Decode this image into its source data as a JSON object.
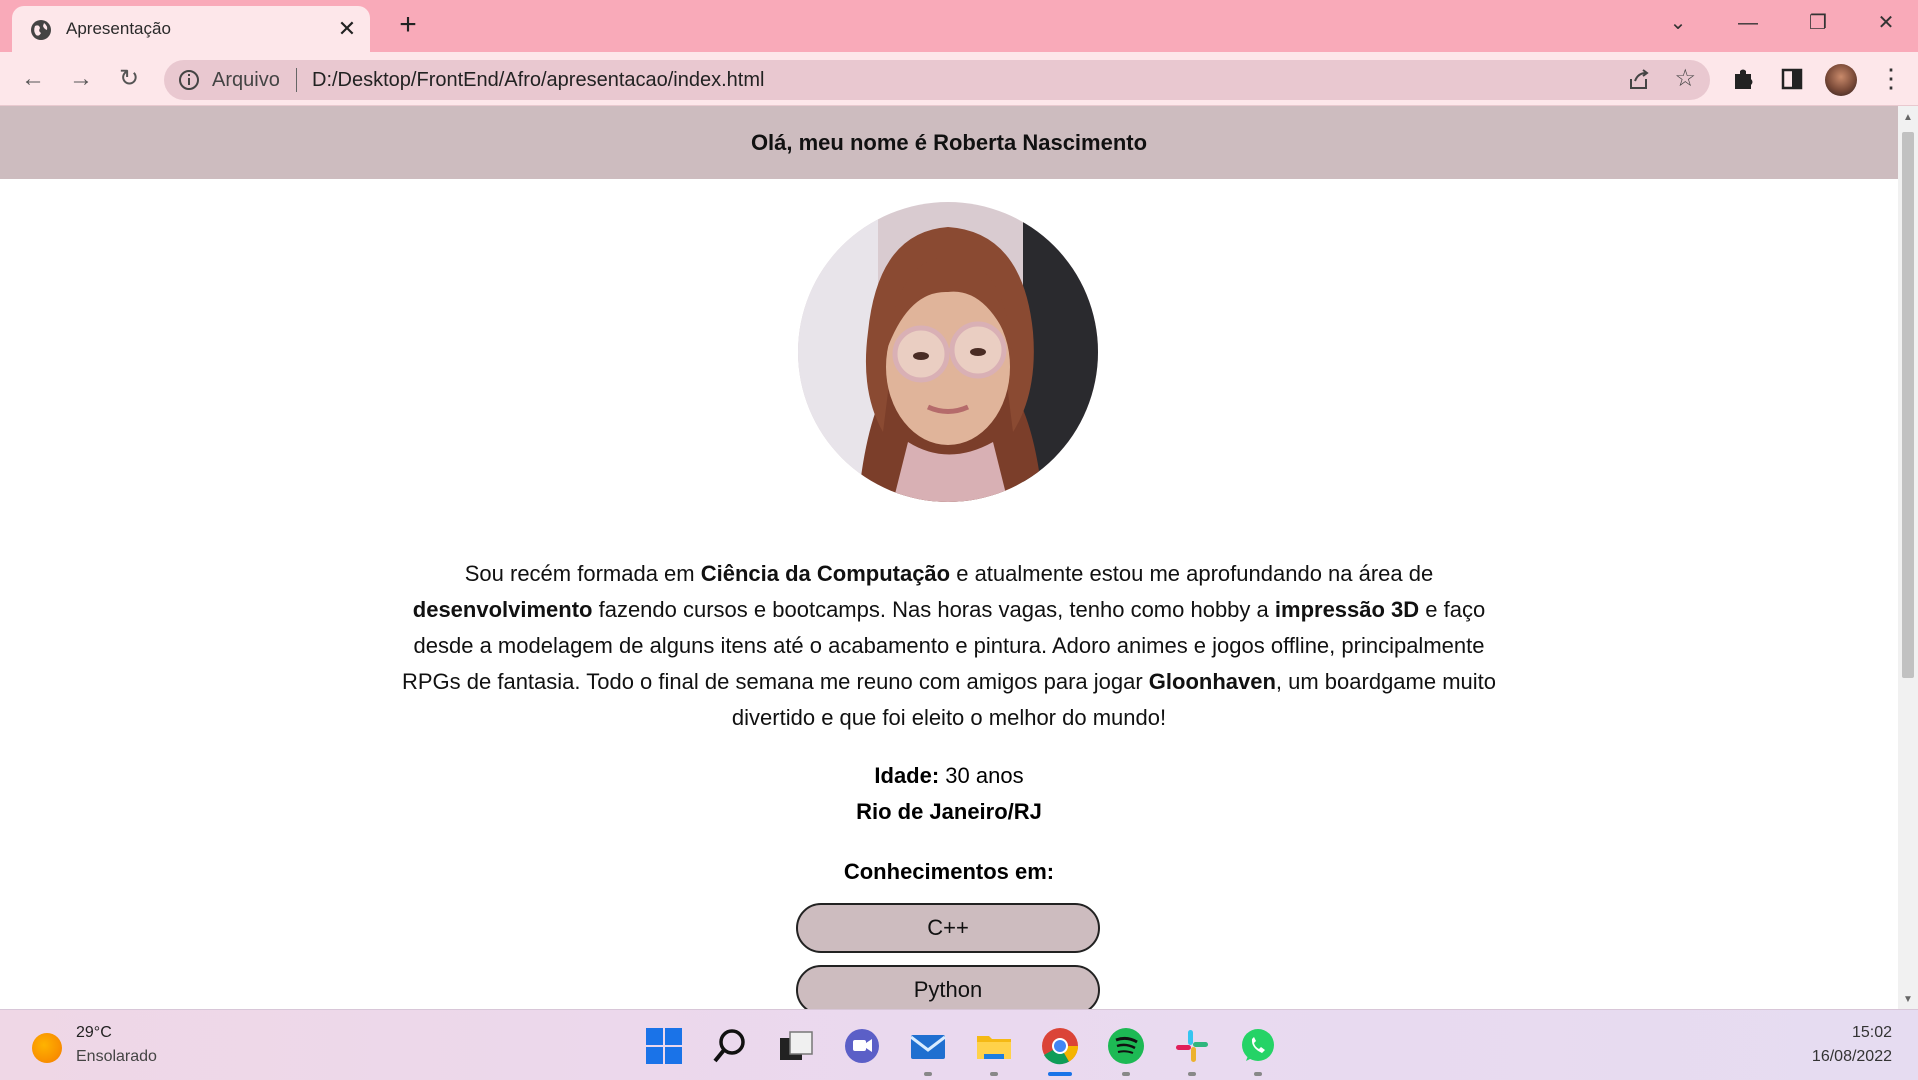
{
  "browser": {
    "tab_title": "Apresentação",
    "omnibox_label": "Arquivo",
    "url": "D:/Desktop/FrontEnd/Afro/apresentacao/index.html",
    "theme_color": "#f9aab9"
  },
  "page": {
    "header": "Olá, meu nome é Roberta Nascimento",
    "bio": [
      {
        "text": "Sou recém formada em ",
        "bold": false
      },
      {
        "text": "Ciência da Computação",
        "bold": true
      },
      {
        "text": " e atualmente estou me aprofundando na área de ",
        "bold": false
      },
      {
        "text": "desenvolvimento",
        "bold": true
      },
      {
        "text": " fazendo cursos e bootcamps. Nas horas vagas, tenho como hobby a ",
        "bold": false
      },
      {
        "text": "impressão 3D",
        "bold": true
      },
      {
        "text": " e faço desde a modelagem de alguns itens até o acabamento e pintura. Adoro animes e jogos offline, principalmente RPGs de fantasia. Todo o final de semana me reuno com amigos para jogar ",
        "bold": false
      },
      {
        "text": "Gloonhaven",
        "bold": true
      },
      {
        "text": ", um boardgame muito divertido e que foi eleito o melhor do mundo!",
        "bold": false
      }
    ],
    "age_label": "Idade:",
    "age_value": " 30 anos",
    "city": "Rio de Janeiro/RJ",
    "skills_title": "Conhecimentos em:",
    "skills": [
      "C++",
      "Python"
    ],
    "header_bg": "#cdbcbf"
  },
  "taskbar": {
    "weather_temp": "29°C",
    "weather_desc": "Ensolarado",
    "time": "15:02",
    "date": "16/08/2022"
  }
}
